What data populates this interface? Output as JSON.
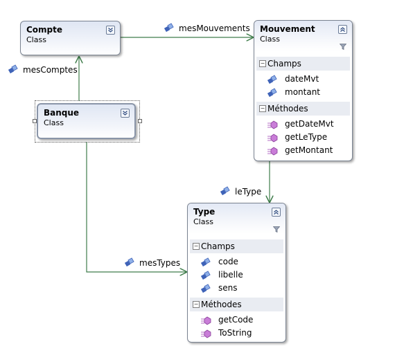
{
  "colors": {
    "connector": "#3e7c4a",
    "header_gradient_top": "#e3e9f5",
    "section_bg": "#e9ecf2",
    "border": "#7a8391"
  },
  "classes": {
    "compte": {
      "name": "Compte",
      "kind": "Class",
      "toggle_icon": "chevron-double-down-icon"
    },
    "mouvement": {
      "name": "Mouvement",
      "kind": "Class",
      "toggle_icon": "chevron-double-up-icon",
      "fields_label": "Champs",
      "fields": [
        "dateMvt",
        "montant"
      ],
      "methods_label": "Méthodes",
      "methods": [
        "getDateMvt",
        "getLeType",
        "getMontant"
      ]
    },
    "banque": {
      "name": "Banque",
      "kind": "Class",
      "toggle_icon": "chevron-double-down-icon"
    },
    "type": {
      "name": "Type",
      "kind": "Class",
      "toggle_icon": "chevron-double-up-icon",
      "fields_label": "Champs",
      "fields": [
        "code",
        "libelle",
        "sens"
      ],
      "methods_label": "Méthodes",
      "methods": [
        "getCode",
        "ToString"
      ]
    }
  },
  "associations": {
    "mesMouvements": "mesMouvements",
    "mesComptes": "mesComptes",
    "leType": "leType",
    "mesTypes": "mesTypes"
  },
  "icons": {
    "field": "field-icon",
    "method": "method-icon",
    "association": "association-icon",
    "filter": "filter-icon"
  }
}
